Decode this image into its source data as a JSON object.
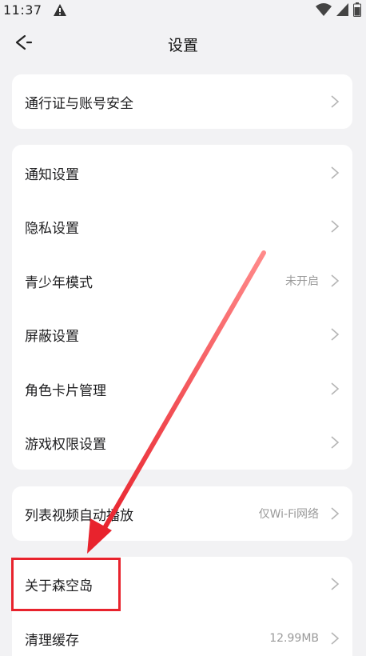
{
  "status_bar": {
    "time": "11:37",
    "icons": [
      "warning-icon",
      "wifi-icon",
      "signal-icon",
      "battery-icon"
    ]
  },
  "header": {
    "title": "设置",
    "back_icon": "back-arrow-icon"
  },
  "groups": [
    {
      "items": [
        {
          "label": "通行证与账号安全",
          "value": ""
        }
      ]
    },
    {
      "items": [
        {
          "label": "通知设置",
          "value": ""
        },
        {
          "label": "隐私设置",
          "value": ""
        },
        {
          "label": "青少年模式",
          "value": "未开启"
        },
        {
          "label": "屏蔽设置",
          "value": ""
        },
        {
          "label": "角色卡片管理",
          "value": ""
        },
        {
          "label": "游戏权限设置",
          "value": ""
        }
      ]
    },
    {
      "items": [
        {
          "label": "列表视频自动播放",
          "value": "仅Wi-Fi网络"
        }
      ]
    },
    {
      "items": [
        {
          "label": "关于森空岛",
          "value": ""
        },
        {
          "label": "清理缓存",
          "value": "12.99MB"
        }
      ]
    }
  ],
  "colors": {
    "background": "#f2f2f4",
    "card": "#ffffff",
    "annotation": "#e8232d",
    "secondary_text": "#9a9a9a"
  },
  "annotation": {
    "highlighted_item": "关于森空岛"
  }
}
